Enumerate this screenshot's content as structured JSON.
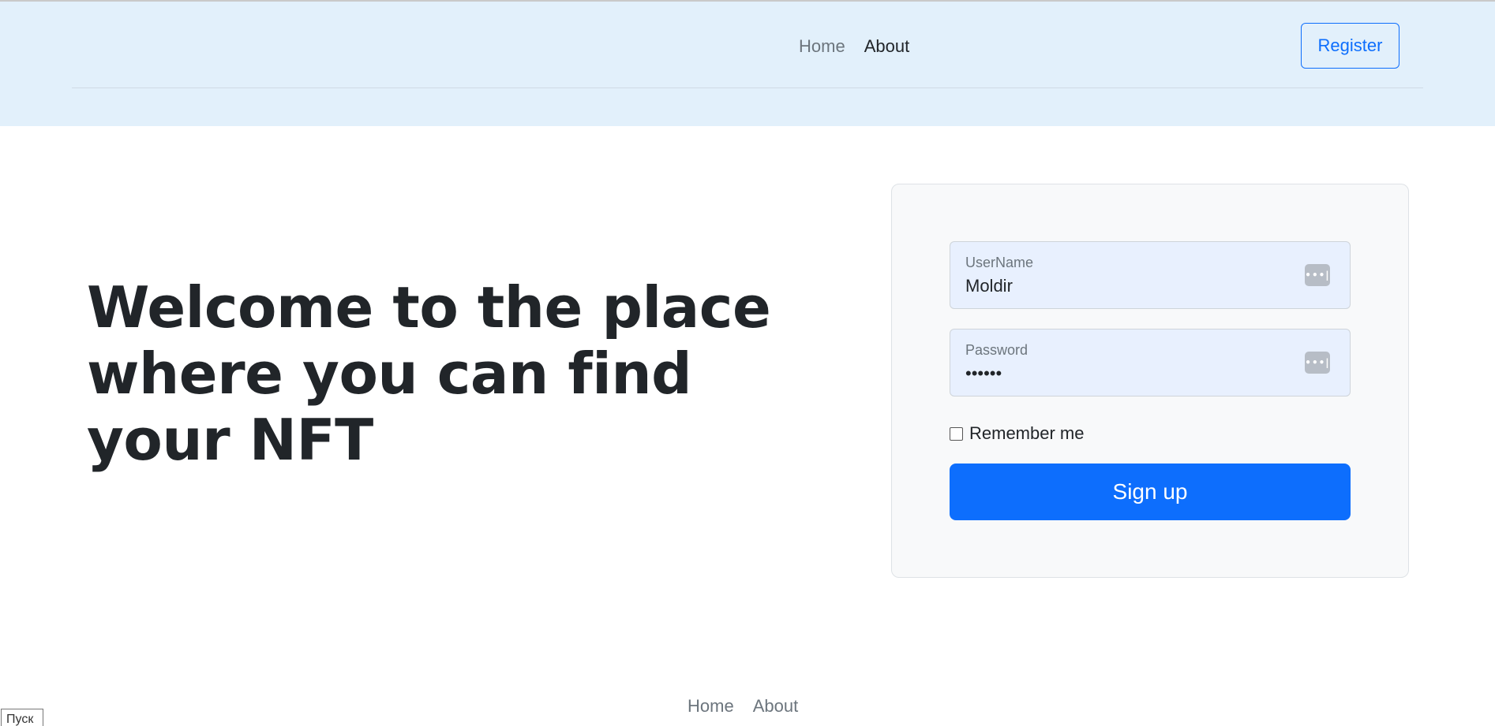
{
  "header": {
    "nav": [
      {
        "label": "Home",
        "active": false
      },
      {
        "label": "About",
        "active": true
      }
    ],
    "register_label": "Register"
  },
  "hero": {
    "title": "Welcome to the place where you can find your NFT"
  },
  "login": {
    "username": {
      "label": "UserName",
      "value": "Moldir",
      "icon": "password-manager-key-icon"
    },
    "password": {
      "label": "Password",
      "value": "••••••",
      "icon": "password-manager-key-icon"
    },
    "remember_label": "Remember me",
    "remember_checked": false,
    "submit_label": "Sign up"
  },
  "footer": {
    "nav": [
      {
        "label": "Home"
      },
      {
        "label": "About"
      }
    ]
  },
  "taskbar": {
    "start_label": "Пуск"
  },
  "colors": {
    "header_bg": "#e2f0fb",
    "primary": "#0d6efd",
    "card_bg": "#f8f9fa",
    "field_bg": "#e8f0fe"
  }
}
